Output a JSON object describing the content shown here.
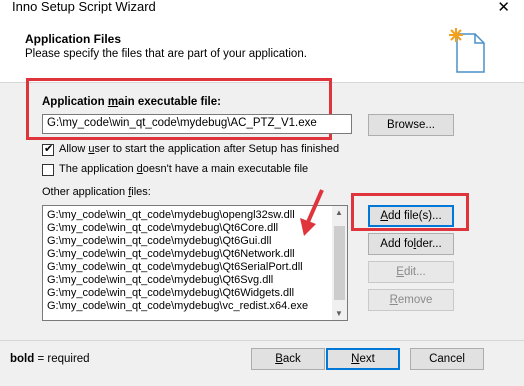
{
  "window": {
    "title": "Inno Setup Script Wizard",
    "close_glyph": "✕"
  },
  "header": {
    "title": "Application Files",
    "description": "Please specify the files that are part of your application."
  },
  "main_exe": {
    "label_pre": "Application ",
    "label_u": "m",
    "label_post": "ain executable file:",
    "value": "G:\\my_code\\win_qt_code\\mydebug\\AC_PTZ_V1.exe",
    "browse_label": "Browse..."
  },
  "options": {
    "allow_start": {
      "pre": "Allow ",
      "u": "u",
      "post": "ser to start the application after Setup has finished",
      "checked": true
    },
    "no_main_exe": {
      "pre": "The application ",
      "u": "d",
      "post": "oesn't have a main executable file",
      "checked": false
    }
  },
  "other_files": {
    "label_pre": "Other application ",
    "label_u": "f",
    "label_post": "iles:",
    "items": [
      "G:\\my_code\\win_qt_code\\mydebug\\opengl32sw.dll",
      "G:\\my_code\\win_qt_code\\mydebug\\Qt6Core.dll",
      "G:\\my_code\\win_qt_code\\mydebug\\Qt6Gui.dll",
      "G:\\my_code\\win_qt_code\\mydebug\\Qt6Network.dll",
      "G:\\my_code\\win_qt_code\\mydebug\\Qt6SerialPort.dll",
      "G:\\my_code\\win_qt_code\\mydebug\\Qt6Svg.dll",
      "G:\\my_code\\win_qt_code\\mydebug\\Qt6Widgets.dll",
      "G:\\my_code\\win_qt_code\\mydebug\\vc_redist.x64.exe"
    ]
  },
  "side_buttons": {
    "add_files": {
      "pre": "",
      "u": "A",
      "post": "dd file(s)..."
    },
    "add_folder": {
      "pre": "Add fo",
      "u": "l",
      "post": "der..."
    },
    "edit": {
      "pre": "",
      "u": "E",
      "post": "dit..."
    },
    "remove": {
      "pre": "",
      "u": "R",
      "post": "emove"
    }
  },
  "footer": {
    "legend_bold": "bold",
    "legend_rest": " = required",
    "back": {
      "pre": "",
      "u": "B",
      "post": "ack"
    },
    "next": {
      "pre": "",
      "u": "N",
      "post": "ext"
    },
    "cancel": "Cancel"
  },
  "colors": {
    "highlight": "#e0343d",
    "focus": "#0078d7"
  }
}
